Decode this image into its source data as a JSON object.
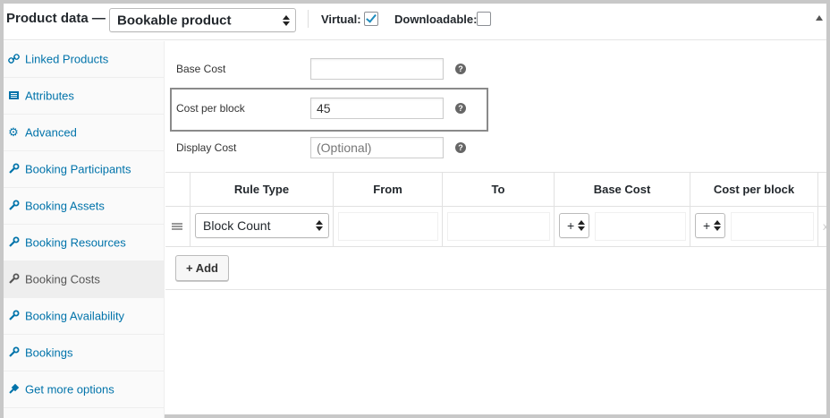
{
  "header": {
    "title": "Product data —",
    "product_type": "Bookable product",
    "virtual_label": "Virtual:",
    "virtual_checked": true,
    "downloadable_label": "Downloadable:",
    "downloadable_checked": false
  },
  "sidebar": {
    "items": [
      {
        "label": "Linked Products",
        "icon": "link-icon"
      },
      {
        "label": "Attributes",
        "icon": "list-icon"
      },
      {
        "label": "Advanced",
        "icon": "gear-icon"
      },
      {
        "label": "Booking Participants",
        "icon": "wrench-icon"
      },
      {
        "label": "Booking Assets",
        "icon": "wrench-icon"
      },
      {
        "label": "Booking Resources",
        "icon": "wrench-icon"
      },
      {
        "label": "Booking Costs",
        "icon": "wrench-icon",
        "active": true
      },
      {
        "label": "Booking Availability",
        "icon": "wrench-icon"
      },
      {
        "label": "Bookings",
        "icon": "wrench-icon"
      },
      {
        "label": "Get more options",
        "icon": "plugin-icon"
      }
    ]
  },
  "fields": {
    "base_cost": {
      "label": "Base Cost",
      "value": ""
    },
    "cost_per_block": {
      "label": "Cost per block",
      "value": "45"
    },
    "display_cost": {
      "label": "Display Cost",
      "placeholder": "(Optional)"
    }
  },
  "table": {
    "headers": [
      "Rule Type",
      "From",
      "To",
      "Base Cost",
      "Cost per block"
    ],
    "row": {
      "rule_type": "Block Count",
      "base_cost_modifier": "+",
      "cost_per_block_modifier": "+"
    },
    "add_label": "+ Add",
    "remove_label": "x"
  }
}
